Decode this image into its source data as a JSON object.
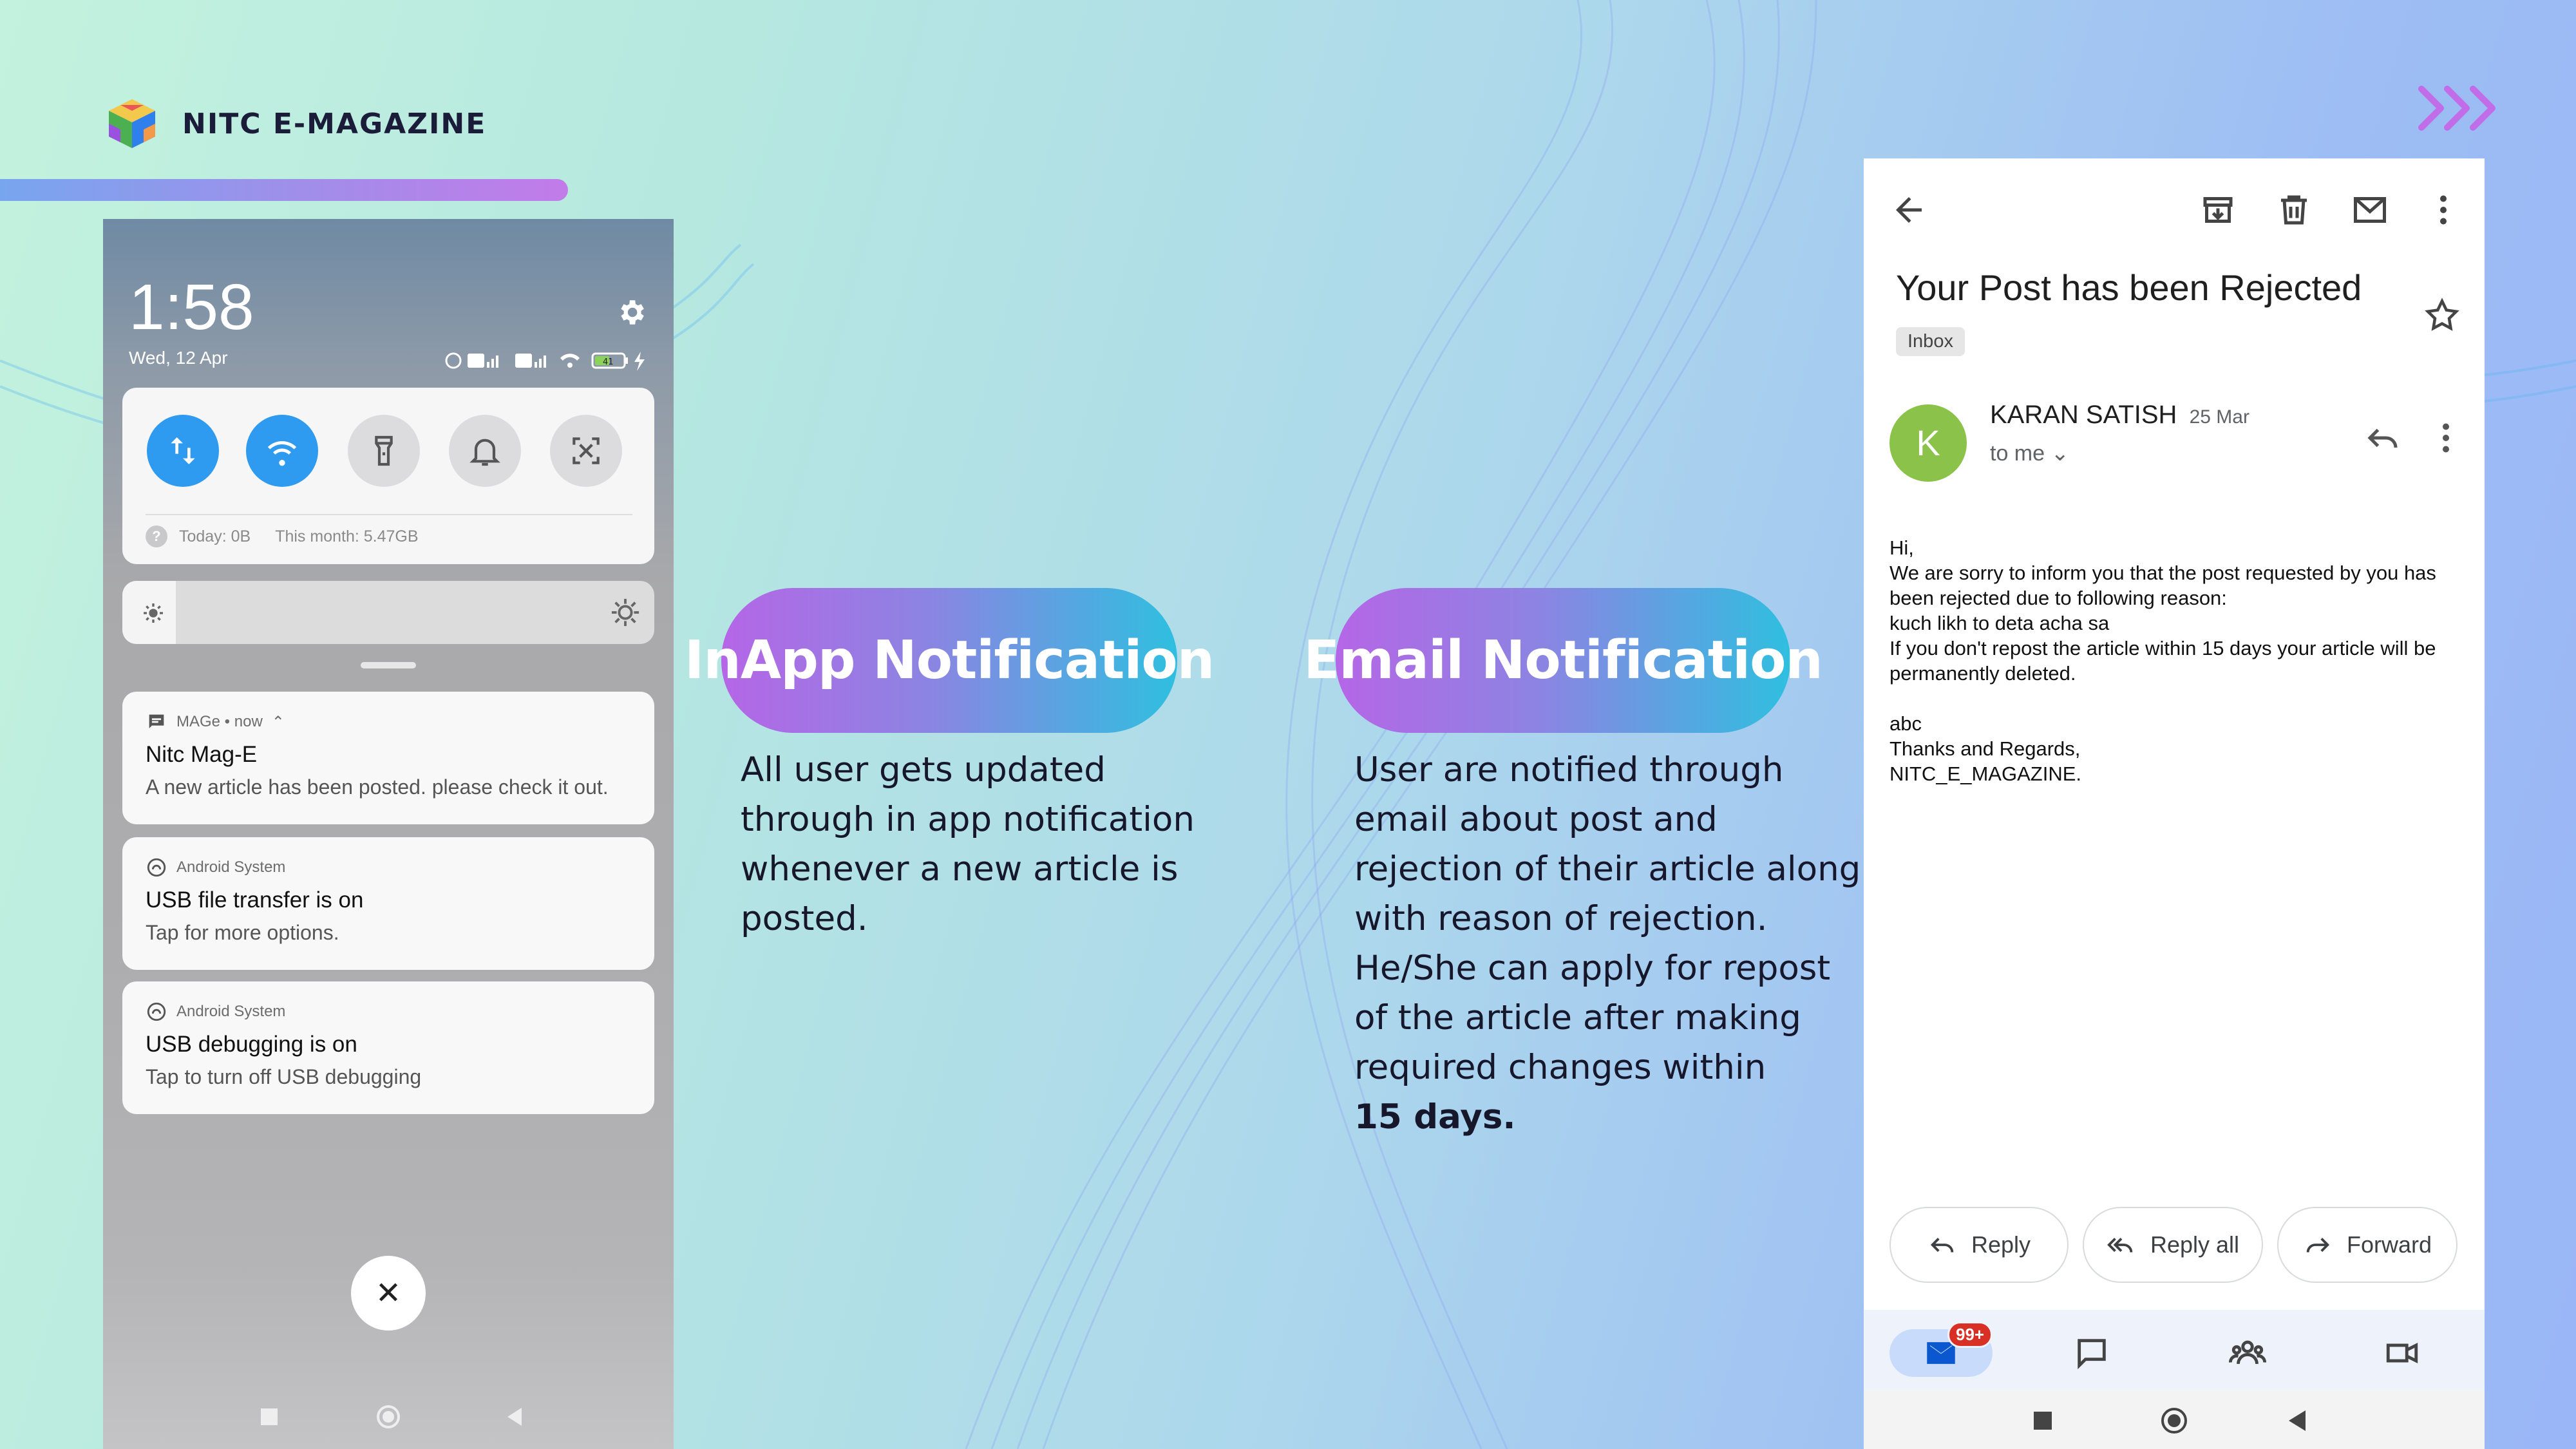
{
  "brand": {
    "title": "NITC E-MAGAZINE"
  },
  "phone": {
    "time": "1:58",
    "date": "Wed, 12 Apr",
    "battery": "41",
    "data_usage": {
      "today": "Today: 0B",
      "month": "This month: 5.47GB"
    },
    "brightness_level": 0.1,
    "notifications": [
      {
        "app": "MAGe • now",
        "title": "Nitc Mag-E",
        "body": "A new article has been posted. please check it out."
      },
      {
        "app": "Android System",
        "title": "USB file transfer is on",
        "body": "Tap for more options."
      },
      {
        "app": "Android System",
        "title": "USB debugging is on",
        "body": "Tap to turn off USB debugging"
      }
    ]
  },
  "features": {
    "inapp": {
      "title": "InApp Notification",
      "lines": [
        "All user gets updated",
        "through in app notification",
        "whenever a new article is",
        "posted."
      ]
    },
    "email": {
      "title": "Email Notification",
      "lines": [
        "User are notified through",
        "email about post and",
        "rejection of their article along",
        "with reason of rejection.",
        "He/She can apply for repost",
        "of the article after making",
        "required changes within"
      ],
      "emphasis": "15 days."
    }
  },
  "email": {
    "subject": "Your Post has been Rejected",
    "folder": "Inbox",
    "avatar_letter": "K",
    "sender": "KARAN SATISH",
    "date": "25 Mar",
    "to": "to me",
    "body": "Hi,\nWe are sorry to inform you that the post requested by you has been rejected due to following reason:\nkuch likh to deta acha sa\nIf you don't repost the article within 15 days your article will be permanently deleted.\n\nabc\nThanks and Regards,\nNITC_E_MAGAZINE.",
    "actions": {
      "reply": "Reply",
      "reply_all": "Reply all",
      "forward": "Forward"
    },
    "mail_badge": "99+"
  },
  "colors": {
    "accent_blue": "#2e9bf0",
    "pill_start": "#b566e6",
    "pill_end": "#2fbfe0",
    "avatar_green": "#8bc34a",
    "badge_red": "#d93025"
  }
}
